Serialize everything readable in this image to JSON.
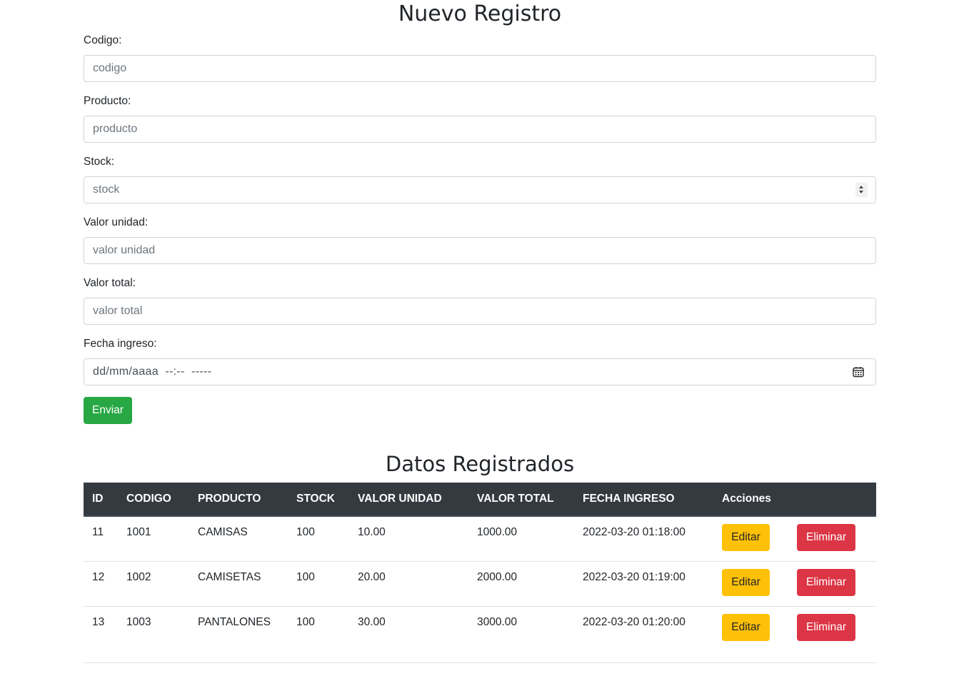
{
  "form": {
    "title": "Nuevo Registro",
    "fields": [
      {
        "label": "Codigo:",
        "placeholder": "codigo"
      },
      {
        "label": "Producto:",
        "placeholder": "producto"
      },
      {
        "label": "Stock:",
        "placeholder": "stock"
      },
      {
        "label": "Valor unidad:",
        "placeholder": "valor unidad"
      },
      {
        "label": "Valor total:",
        "placeholder": "valor total"
      },
      {
        "label": "Fecha ingreso:",
        "placeholder": "dd/mm/aaaa  --:--  -----"
      }
    ],
    "submit_label": "Enviar"
  },
  "table": {
    "title": "Datos Registrados",
    "headers": [
      "ID",
      "CODIGO",
      "PRODUCTO",
      "STOCK",
      "VALOR UNIDAD",
      "VALOR TOTAL",
      "FECHA INGRESO",
      "Acciones"
    ],
    "rows": [
      {
        "id": "11",
        "codigo": "1001",
        "producto": "CAMISAS",
        "stock": "100",
        "valor_unidad": "10.00",
        "valor_total": "1000.00",
        "fecha": "2022-03-20 01:18:00",
        "edit_label": "Editar",
        "delete_label": "Eliminar"
      },
      {
        "id": "12",
        "codigo": "1002",
        "producto": "CAMISETAS",
        "stock": "100",
        "valor_unidad": "20.00",
        "valor_total": "2000.00",
        "fecha": "2022-03-20 01:19:00",
        "edit_label": "Editar",
        "delete_label": "Eliminar"
      },
      {
        "id": "13",
        "codigo": "1003",
        "producto": "PANTALONES",
        "stock": "100",
        "valor_unidad": "30.00",
        "valor_total": "3000.00",
        "fecha": "2022-03-20 01:20:00",
        "edit_label": "Editar",
        "delete_label": "Eliminar"
      }
    ]
  },
  "colors": {
    "success": "#28a745",
    "warning": "#ffc107",
    "danger": "#dc3545",
    "table_header": "#343a40"
  },
  "icons": {
    "stock_spinner": "spinner-arrows-icon",
    "date_picker": "calendar-icon"
  }
}
